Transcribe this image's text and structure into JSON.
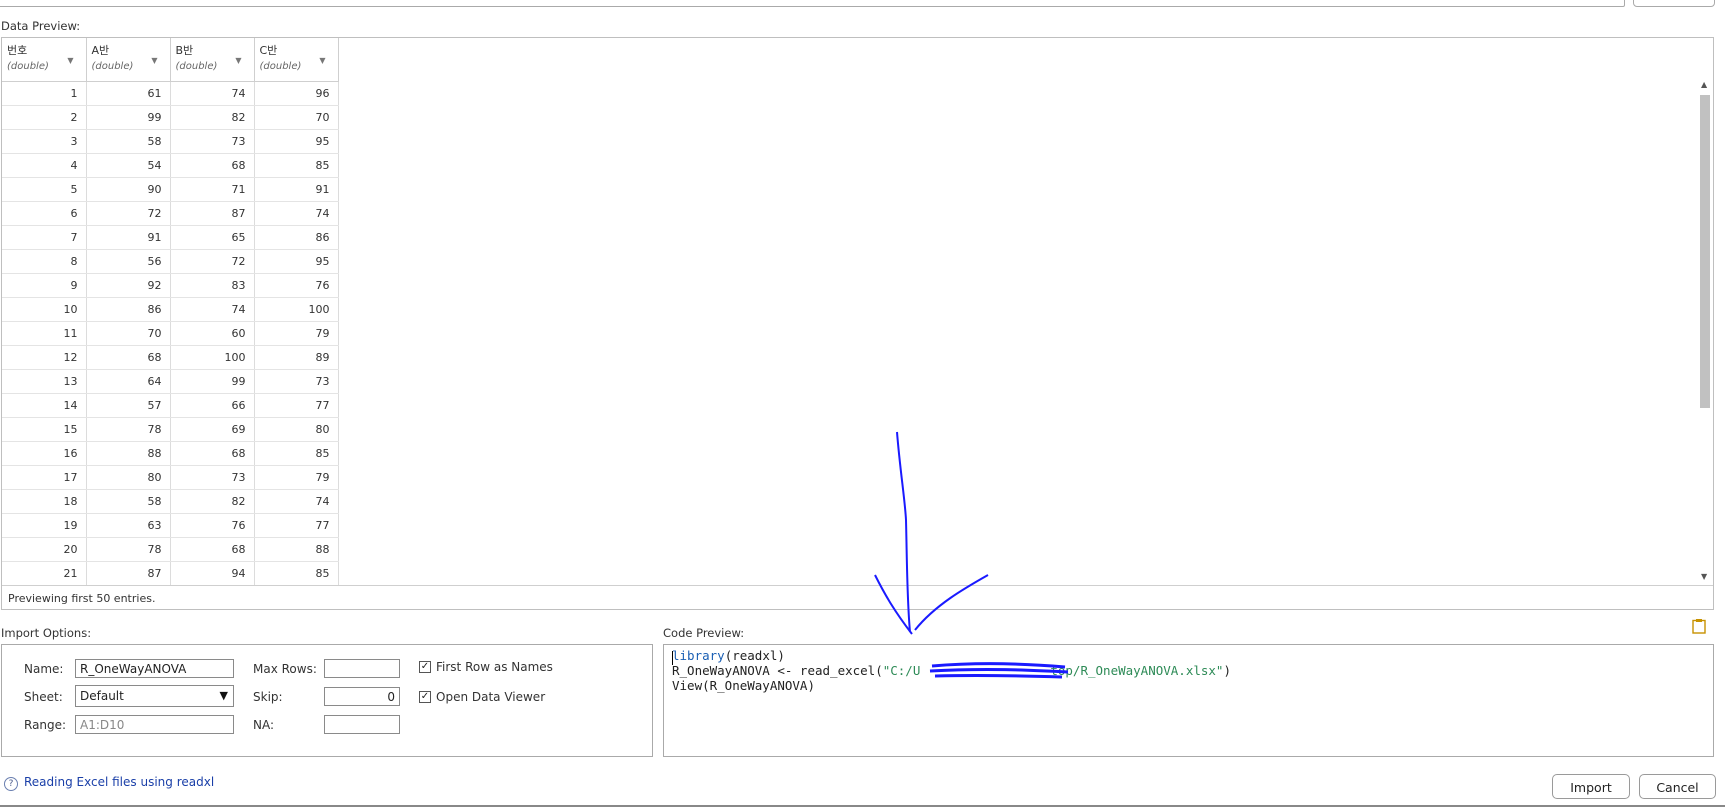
{
  "labels": {
    "data_preview": "Data Preview:",
    "import_options": "Import Options:",
    "code_preview": "Code Preview:"
  },
  "table": {
    "columns": [
      {
        "name": "번호",
        "type": "(double)"
      },
      {
        "name": "A반",
        "type": "(double)"
      },
      {
        "name": "B반",
        "type": "(double)"
      },
      {
        "name": "C반",
        "type": "(double)"
      }
    ],
    "rows": [
      [
        1,
        61,
        74,
        96
      ],
      [
        2,
        99,
        82,
        70
      ],
      [
        3,
        58,
        73,
        95
      ],
      [
        4,
        54,
        68,
        85
      ],
      [
        5,
        90,
        71,
        91
      ],
      [
        6,
        72,
        87,
        74
      ],
      [
        7,
        91,
        65,
        86
      ],
      [
        8,
        56,
        72,
        95
      ],
      [
        9,
        92,
        83,
        76
      ],
      [
        10,
        86,
        74,
        100
      ],
      [
        11,
        70,
        60,
        79
      ],
      [
        12,
        68,
        100,
        89
      ],
      [
        13,
        64,
        99,
        73
      ],
      [
        14,
        57,
        66,
        77
      ],
      [
        15,
        78,
        69,
        80
      ],
      [
        16,
        88,
        68,
        85
      ],
      [
        17,
        80,
        73,
        79
      ],
      [
        18,
        58,
        82,
        74
      ],
      [
        19,
        63,
        76,
        77
      ],
      [
        20,
        78,
        68,
        88
      ],
      [
        21,
        87,
        94,
        85
      ]
    ],
    "footer": "Previewing first 50 entries."
  },
  "options": {
    "name_label": "Name:",
    "name_value": "R_OneWayANOVA",
    "sheet_label": "Sheet:",
    "sheet_value": "Default",
    "range_label": "Range:",
    "range_placeholder": "A1:D10",
    "max_rows_label": "Max Rows:",
    "max_rows_value": "",
    "skip_label": "Skip:",
    "skip_value": "0",
    "na_label": "NA:",
    "na_value": "",
    "first_row_label": "First Row as Names",
    "first_row_checked": true,
    "open_viewer_label": "Open Data Viewer",
    "open_viewer_checked": true
  },
  "code": {
    "line1_fn": "library",
    "line1_rest": "(readxl)",
    "line2_start": "R_OneWayANOVA <- read_excel(",
    "line2_str": "\"C:/U",
    "line2_str_end": "top/R_OneWayANOVA.xlsx\"",
    "line2_end": ")",
    "line3": "View(R_OneWayANOVA)"
  },
  "footer": {
    "help_icon": "?",
    "help_link": "Reading Excel files using readxl",
    "import_button": "Import",
    "cancel_button": "Cancel"
  },
  "icons": {
    "clipboard": "clipboard-icon",
    "dropdown": "chevron-down-icon"
  },
  "colors": {
    "annotation": "#1a1aff",
    "link": "#1a3fa8"
  }
}
